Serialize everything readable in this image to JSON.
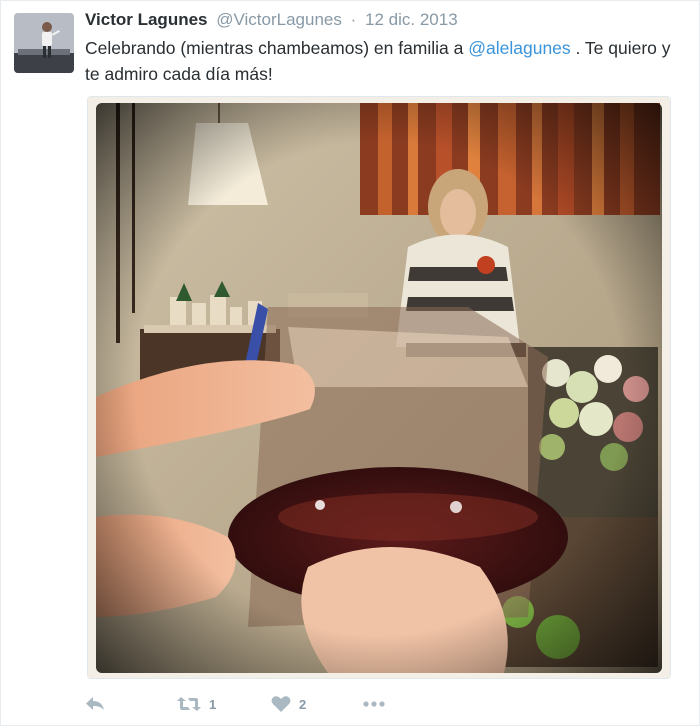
{
  "tweet": {
    "fullname": "Victor Lagunes",
    "username": "@VictorLagunes",
    "separator": "·",
    "timestamp": "12 dic. 2013",
    "text_before": "Celebrando (mientras chambeamos) en familia a ",
    "mention": "@alelagunes",
    "text_after": " . Te quiero y te admiro cada día más!"
  },
  "actions": {
    "retweet_count": "1",
    "like_count": "2"
  },
  "icons": {
    "reply": "reply-icon",
    "retweet": "retweet-icon",
    "like": "heart-icon",
    "more": "more-icon"
  },
  "colors": {
    "mention": "#3b94d9",
    "muted": "#8899a6",
    "icon": "#aab8c2"
  }
}
